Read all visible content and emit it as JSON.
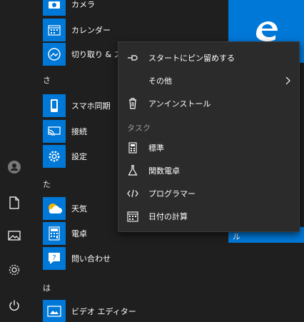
{
  "rail": {
    "items": [
      {
        "name": "user-avatar",
        "icon": "user-icon"
      },
      {
        "name": "documents",
        "icon": "document-icon"
      },
      {
        "name": "pictures",
        "icon": "image-icon"
      },
      {
        "name": "settings",
        "icon": "gear-icon"
      },
      {
        "name": "power",
        "icon": "power-icon"
      }
    ]
  },
  "apps": {
    "camera": "カメラ",
    "calendar": "カレンダー",
    "snip": "切り取り & ス",
    "group_sa": "さ",
    "phone": "スマホ同期",
    "connect": "接続",
    "settings": "設定",
    "group_ta": "た",
    "weather": "天気",
    "calculator": "電卓",
    "contact": "問い合わせ",
    "group_ha": "は",
    "video": "ビデオ エディター"
  },
  "tiles": {
    "bottom_label": "ル"
  },
  "context_menu": {
    "pin_start": "スタートにピン留めする",
    "more": "その他",
    "uninstall": "アンインストール",
    "section_tasks": "タスク",
    "standard": "標準",
    "scientific": "関数電卓",
    "programmer": "プログラマー",
    "date_calc": "日付の計算"
  },
  "colors": {
    "accent": "#0078d7",
    "menu_bg": "#2b2b2b",
    "start_bg": "#1f1f1f"
  }
}
